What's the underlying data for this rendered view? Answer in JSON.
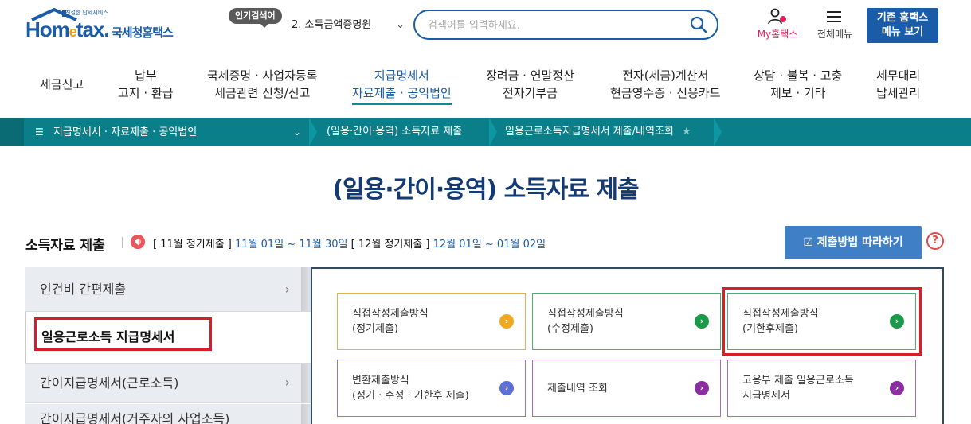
{
  "header": {
    "logo_small": "친절한 납세서비스",
    "logo_main": "Hometax",
    "logo_kr": "국세청홈택스",
    "popular_badge": "인기검색어",
    "popular_selected": "2.  소득금액증명원",
    "search_placeholder": "검색어를 입력하세요.",
    "my_hometax": "My홈택스",
    "all_menu": "전체메뉴",
    "old_hometax_line1": "기존 홈택스",
    "old_hometax_line2": "메뉴 보기"
  },
  "gnb": [
    {
      "line1": "세금신고",
      "line2": ""
    },
    {
      "line1": "납부",
      "line2": "고지 · 환급"
    },
    {
      "line1": "국세증명 · 사업자등록",
      "line2": "세금관련 신청/신고"
    },
    {
      "line1": "지급명세서",
      "line2": "자료제출 · 공익법인"
    },
    {
      "line1": "장려금 · 연말정산",
      "line2": "전자기부금"
    },
    {
      "line1": "전자(세금)계산서",
      "line2": "현금영수증 · 신용카드"
    },
    {
      "line1": "상담 · 불복 · 고충",
      "line2": "제보 · 기타"
    },
    {
      "line1": "세무대리",
      "line2": "납세관리"
    }
  ],
  "breadcrumb": {
    "menu": "지급명세서 · 자료제출 · 공익법인",
    "step1": "(일용·간이·용역) 소득자료 제출",
    "step2": "일용근로소득지급명세서 제출/내역조회"
  },
  "page_title": "(일용·간이·용역) 소득자료 제출",
  "section": {
    "title": "소득자료 제출",
    "sched1_label": "[ 11월 정기제출 ]",
    "sched1_range": "11월 01일 ~ 11월 30일",
    "sched2_label": "[ 12월 정기제출 ]",
    "sched2_range": "12월 01일 ~ 01월 02일",
    "follow_button": "제출방법 따라하기",
    "help": "?"
  },
  "side_menu": [
    {
      "label": "인건비 간편제출"
    },
    {
      "label": "일용근로소득 지급명세서"
    },
    {
      "label": "간이지급명세서(근로소득)"
    },
    {
      "label": "간이지급명세서(거주자의 사업소득)"
    }
  ],
  "cards": [
    {
      "line1": "직접작성제출방식",
      "line2": "(정기제출)",
      "color": "#f0a81e",
      "border": "#e6b04c"
    },
    {
      "line1": "직접작성제출방식",
      "line2": "(수정제출)",
      "color": "#1a9a48",
      "border": "#4bb06c"
    },
    {
      "line1": "직접작성제출방식",
      "line2": "(기한후제출)",
      "color": "#1a9a48",
      "border": "#4bb06c"
    },
    {
      "line1": "변환제출방식",
      "line2": "(정기 · 수정 · 기한후 제출)",
      "color": "#5b6fd6",
      "border": "#8a7bc8"
    },
    {
      "line1": "제출내역 조회",
      "line2": "",
      "color": "#8b2fa0",
      "border": "#a470b5"
    },
    {
      "line1": "고용부 제출 일용근로소득",
      "line2": "지급명세서",
      "color": "#8b2fa0",
      "border": "#a470b5"
    }
  ]
}
